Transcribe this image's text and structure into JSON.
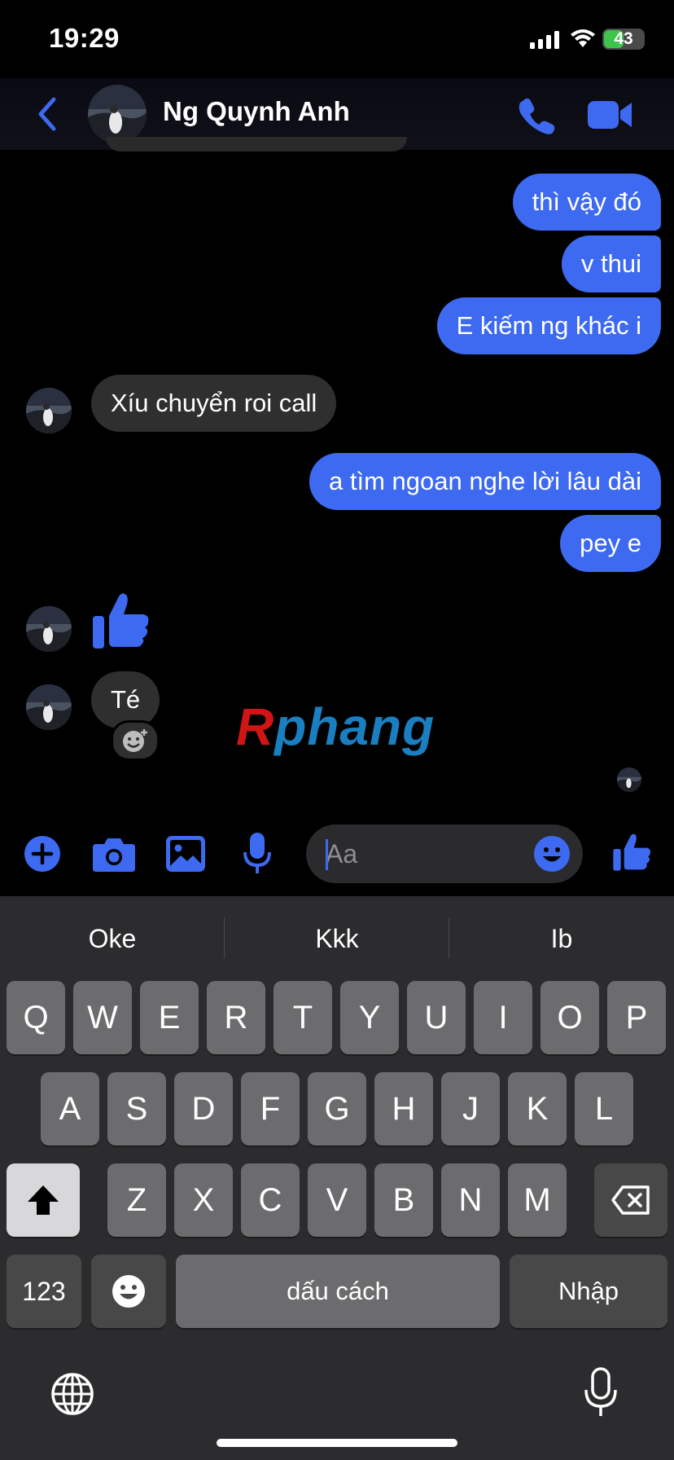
{
  "status_bar": {
    "time": "19:29",
    "battery": "43"
  },
  "header": {
    "contact_name": "Ng Quynh Anh"
  },
  "messages": [
    {
      "from": "me",
      "text": "thì vậy đó"
    },
    {
      "from": "me",
      "text": "v thui"
    },
    {
      "from": "me",
      "text": "E kiếm ng khác i"
    },
    {
      "from": "them",
      "text": "Xíu chuyển roi call"
    },
    {
      "from": "me",
      "text": "a tìm ngoan nghe lời lâu dài"
    },
    {
      "from": "me",
      "text": "pey e"
    },
    {
      "from": "them",
      "type": "like"
    },
    {
      "from": "them",
      "text": "Té"
    }
  ],
  "watermark": {
    "part1": "R",
    "part2": "phang"
  },
  "composer": {
    "placeholder": "Aa"
  },
  "suggestions": [
    "Oke",
    "Kkk",
    "Ib"
  ],
  "keyboard": {
    "row1": [
      "Q",
      "W",
      "E",
      "R",
      "T",
      "Y",
      "U",
      "I",
      "O",
      "P"
    ],
    "row2": [
      "A",
      "S",
      "D",
      "F",
      "G",
      "H",
      "J",
      "K",
      "L"
    ],
    "row3": [
      "Z",
      "X",
      "C",
      "V",
      "B",
      "N",
      "M"
    ],
    "numbers_key": "123",
    "space_key": "dấu cách",
    "return_key": "Nhập"
  },
  "colors": {
    "accent": "#3d6af0",
    "incoming_bubble": "#2f2f2f",
    "keyboard_bg": "#2c2c2e"
  }
}
